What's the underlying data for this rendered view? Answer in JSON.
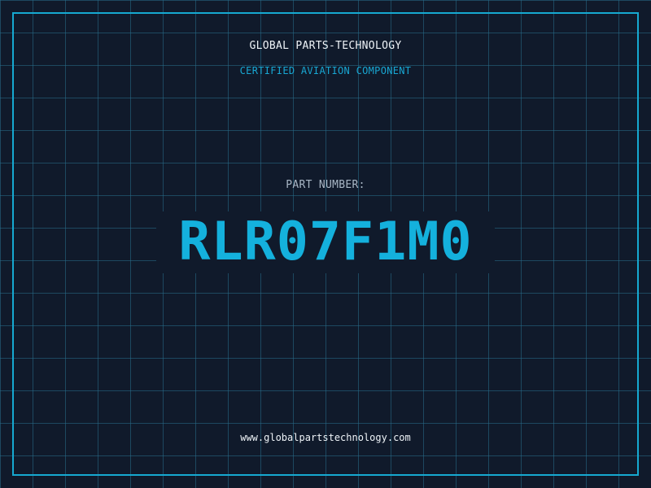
{
  "header": {
    "company": "GLOBAL PARTS-TECHNOLOGY",
    "subtitle": "CERTIFIED AVIATION COMPONENT"
  },
  "part": {
    "label": "PART NUMBER:",
    "number": "RLR07F1M0"
  },
  "footer": {
    "website": "www.globalpartstechnology.com"
  },
  "colors": {
    "background": "#101a2b",
    "grid": "#286e8c",
    "accent": "#16a9d1",
    "text": "#eef3f7",
    "muted": "#a9b7c6"
  }
}
